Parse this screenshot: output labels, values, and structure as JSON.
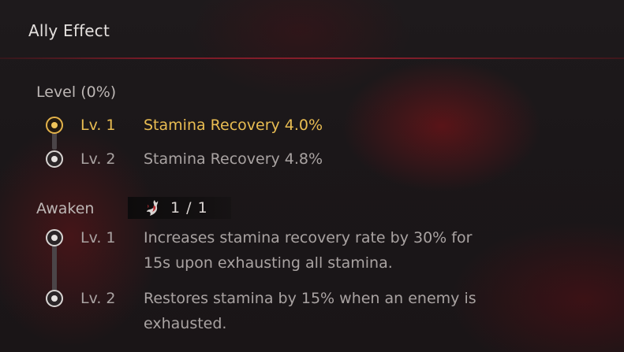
{
  "panel": {
    "title": "Ally Effect"
  },
  "level_section": {
    "label": "Level (0%)",
    "items": [
      {
        "level": "Lv. 1",
        "description": "Stamina Recovery 4.0%",
        "state": "active"
      },
      {
        "level": "Lv. 2",
        "description": "Stamina Recovery 4.8%",
        "state": "inactive"
      }
    ]
  },
  "awaken_section": {
    "label": "Awaken",
    "badge": {
      "icon": "ember-icon",
      "count": "1 / 1"
    },
    "items": [
      {
        "level": "Lv. 1",
        "description_line1": "Increases stamina recovery rate by 30% for",
        "description_line2": "15s upon exhausting all stamina."
      },
      {
        "level": "Lv. 2",
        "description_line1": "Restores stamina by 15% when an enemy is",
        "description_line2": "exhausted."
      }
    ]
  },
  "colors": {
    "accent_gold": "#e9bd52",
    "divider_red": "#8a1f2c",
    "text_muted": "#a9a3a2"
  }
}
